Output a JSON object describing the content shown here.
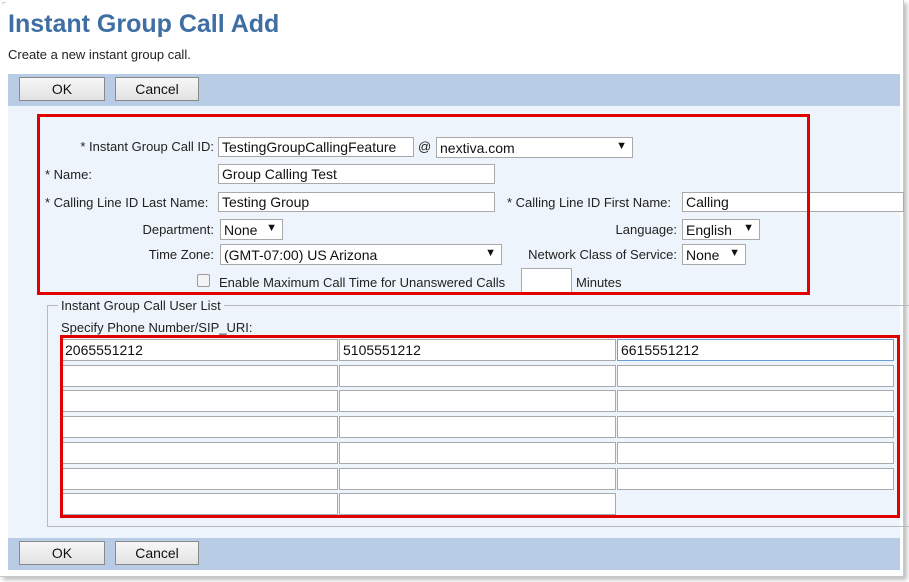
{
  "page": {
    "title": "Instant Group Call Add",
    "subtitle": "Create a new instant group call."
  },
  "buttons": {
    "ok_label": "OK",
    "cancel_label": "Cancel"
  },
  "form": {
    "group_call_id_label": "* Instant Group Call ID:",
    "group_call_id_value": "TestingGroupCallingFeature",
    "at_sign": "@",
    "domain_value": "nextiva.com",
    "name_label": "* Name:",
    "name_value": "Group Calling Test",
    "cli_last_label": "* Calling Line ID Last Name:",
    "cli_last_value": "Testing Group",
    "cli_first_label": "* Calling Line ID First Name:",
    "cli_first_value": "Calling",
    "department_label": "Department:",
    "department_value": "None",
    "language_label": "Language:",
    "language_value": "English",
    "timezone_label": "Time Zone:",
    "timezone_value": "(GMT-07:00) US Arizona",
    "ncos_label": "Network Class of Service:",
    "ncos_value": "None",
    "max_call_label": "Enable Maximum Call Time for Unanswered Calls",
    "max_call_value": "",
    "minutes_label": "Minutes"
  },
  "user_list": {
    "legend": "Instant Group Call User List",
    "specify_label": "Specify Phone Number/SIP_URI:",
    "entries": [
      "2065551212",
      "5105551212",
      "6615551212",
      "",
      "",
      "",
      "",
      "",
      "",
      "",
      "",
      "",
      "",
      "",
      "",
      "",
      "",
      "",
      "",
      ""
    ]
  },
  "colors": {
    "title": "#3e6ea3",
    "button_bar": "#b8cce6",
    "form_background": "#eef4fb",
    "highlight_box": "#e00000"
  }
}
